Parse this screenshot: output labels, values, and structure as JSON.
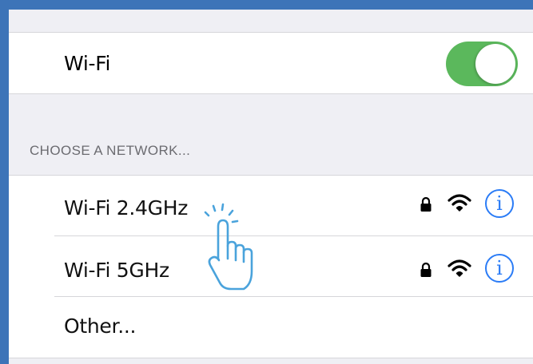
{
  "settings": {
    "wifi_label": "Wi-Fi",
    "wifi_enabled": true,
    "toggle_color": "#5bb85c"
  },
  "networks": {
    "header": "CHOOSE A NETWORK...",
    "items": [
      {
        "name": "Wi-Fi 2.4GHz",
        "secured": true,
        "info_icon": "info-icon"
      },
      {
        "name": "Wi-Fi 5GHz",
        "secured": true,
        "info_icon": "info-icon"
      }
    ],
    "other_label": "Other..."
  },
  "overlay": {
    "pointer_icon": "tap-hand-icon",
    "accent": "#4aa3dc"
  },
  "icons": {
    "info_glyph": "i",
    "lock": "lock-icon",
    "signal": "wifi-signal-icon"
  },
  "colors": {
    "frame": "#3d74b8",
    "background": "#efeff4",
    "info_blue": "#2b7cf6"
  }
}
